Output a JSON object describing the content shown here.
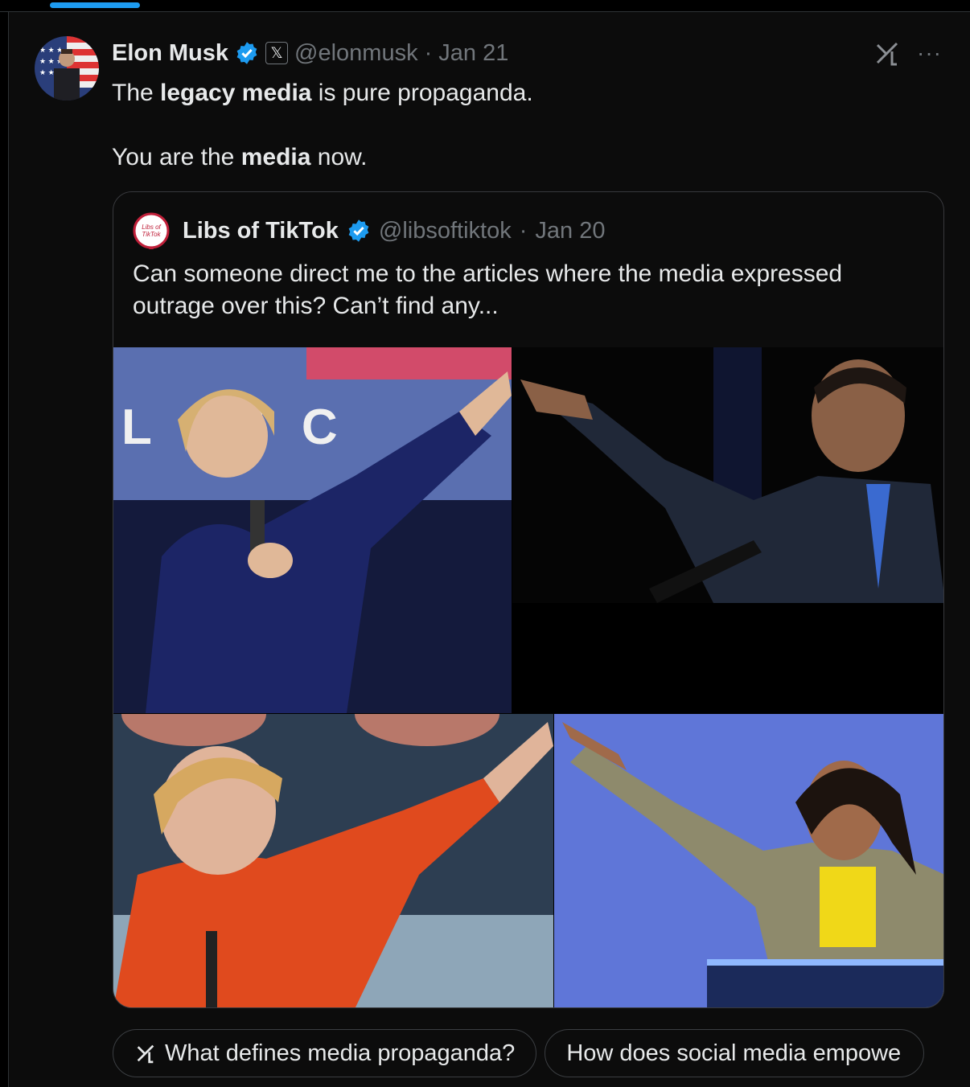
{
  "tweet": {
    "author_name": "Elon Musk",
    "handle": "@elonmusk",
    "separator": "·",
    "date": "Jan 21",
    "line1": {
      "pre": "The ",
      "bold": "legacy media",
      "post": " is pure propaganda."
    },
    "line2": {
      "pre": "You are the ",
      "bold": "media",
      "post": " now."
    }
  },
  "quote": {
    "author_name": "Libs of TikTok",
    "handle": "@libsoftiktok",
    "separator": "·",
    "date": "Jan 20",
    "text": "Can someone direct me to the articles where the media expressed outrage over this? Can’t find any...",
    "avatar_text_top": "Libs of",
    "avatar_text_bottom": "TikTok",
    "sign_text": "L  RY C"
  },
  "grok_prompts": [
    "What defines media propaganda?",
    "How does social media empowe"
  ],
  "icons": {
    "verified": "verified-badge-icon",
    "x_affiliate": "x-logo-icon",
    "grok": "grok-icon",
    "more": "more-icon"
  },
  "colors": {
    "accent": "#1d9bf0",
    "background": "#0c0c0c",
    "muted_text": "#71767b",
    "text": "#e7e9ea"
  }
}
